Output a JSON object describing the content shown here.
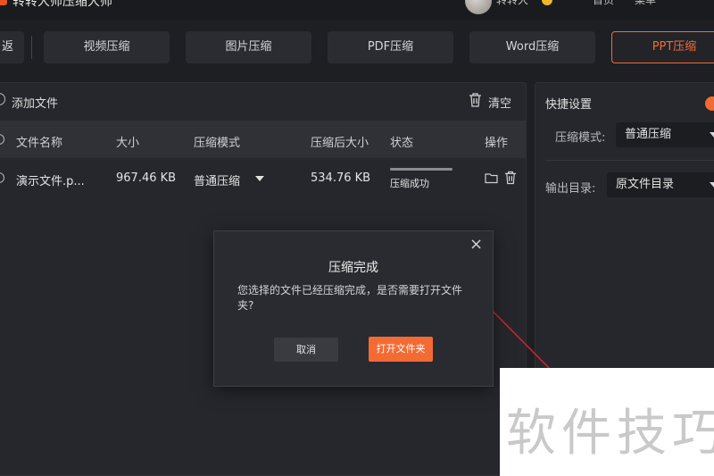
{
  "header": {
    "app_title": "转转大师压缩大师",
    "user_name": "转转大",
    "links": [
      "首页",
      "菜单"
    ]
  },
  "tabs": {
    "back_label": "返回",
    "items": [
      {
        "label": "视频压缩",
        "active": false
      },
      {
        "label": "图片压缩",
        "active": false
      },
      {
        "label": "PDF压缩",
        "active": false
      },
      {
        "label": "Word压缩",
        "active": false
      },
      {
        "label": "PPT压缩",
        "active": true
      }
    ]
  },
  "toolbar": {
    "add_file_label": "添加文件",
    "clear_label": "清空"
  },
  "table": {
    "columns": [
      "文件名称",
      "大小",
      "压缩模式",
      "压缩后大小",
      "状态",
      "操作"
    ],
    "rows": [
      {
        "name": "演示文件.p...",
        "size": "967.46 KB",
        "mode": "普通压缩",
        "compressed_size": "534.76 KB",
        "status": "压缩成功",
        "progress": 1.0
      }
    ]
  },
  "settings": {
    "title": "快捷设置",
    "mode_label": "压缩模式:",
    "mode_value": "普通压缩",
    "output_label": "输出目录:",
    "output_value": "原文件目录"
  },
  "dialog": {
    "title": "压缩完成",
    "message": "您选择的文件已经压缩完成，是否需要打开文件夹?",
    "cancel_label": "取消",
    "open_label": "打开文件夹"
  },
  "watermark": "软件技巧",
  "colors": {
    "accent": "#f36a33",
    "background": "#1e1f23",
    "panel": "#26272c",
    "annotation_line": "#c0282a"
  }
}
